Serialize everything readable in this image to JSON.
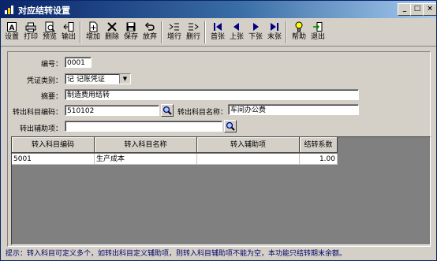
{
  "window": {
    "title": "对应结转设置"
  },
  "toolbar": {
    "buttons": [
      {
        "label": "设置",
        "icon": "settings-icon"
      },
      {
        "label": "打印",
        "icon": "printer-icon"
      },
      {
        "label": "预览",
        "icon": "preview-icon"
      },
      {
        "label": "输出",
        "icon": "export-icon"
      },
      {
        "label": "增加",
        "icon": "add-icon"
      },
      {
        "label": "删除",
        "icon": "delete-icon"
      },
      {
        "label": "保存",
        "icon": "save-icon"
      },
      {
        "label": "放弃",
        "icon": "undo-icon"
      },
      {
        "label": "增行",
        "icon": "add-row-icon"
      },
      {
        "label": "删行",
        "icon": "delete-row-icon"
      },
      {
        "label": "首张",
        "icon": "first-icon"
      },
      {
        "label": "上张",
        "icon": "previous-icon"
      },
      {
        "label": "下张",
        "icon": "next-icon"
      },
      {
        "label": "末张",
        "icon": "last-icon"
      },
      {
        "label": "帮助",
        "icon": "help-icon"
      },
      {
        "label": "退出",
        "icon": "exit-icon"
      }
    ]
  },
  "form": {
    "number_label": "编号：",
    "number_value": "0001",
    "voucher_type_label": "凭证类别：",
    "voucher_type_value": "记    记账凭证",
    "summary_label": "摘要：",
    "summary_value": "制造费用结转",
    "out_account_code_label": "转出科目编码：",
    "out_account_code_value": "510102",
    "out_account_name_label": "转出科目名称：",
    "out_account_name_value": "车间办公费",
    "out_aux_label": "转出辅助项：",
    "out_aux_value": ""
  },
  "grid": {
    "columns": [
      "转入科目编码",
      "转入科目名称",
      "转入辅助项",
      "结转系数"
    ],
    "rows": [
      [
        "5001",
        "生产成本",
        "",
        "1.00"
      ]
    ]
  },
  "status": {
    "text": "提示：转入科目可定义多个，如转出科目定义辅助项，则转入科目辅助项不能为空，本功能只结转期末余额。"
  }
}
